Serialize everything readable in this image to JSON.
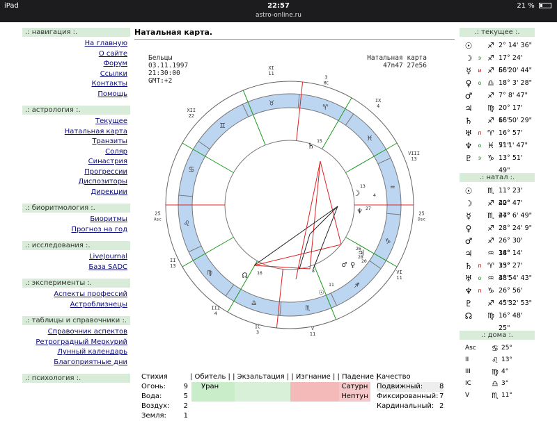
{
  "status_bar": {
    "device": "iPad",
    "time": "22:57",
    "url": "astro-online.ru",
    "battery": "21 %"
  },
  "left_nav": [
    {
      "title": ".: навигация :.",
      "links": [
        "На главную",
        "О сайте",
        "Форум",
        "Ссылки",
        "Контакты",
        "Помощь"
      ]
    },
    {
      "title": ".: астрология :.",
      "links": [
        "Текущее",
        "Натальная карта",
        "Транзиты",
        "Соляр",
        "Синастрия",
        "Прогрессии",
        "Диспозиторы",
        "Дирекции"
      ]
    },
    {
      "title": ".: биоритмология :.",
      "links": [
        "Биоритмы",
        "Прогноз на год"
      ]
    },
    {
      "title": ".: исследования :.",
      "links": [
        "LiveJournal",
        "База SADC"
      ]
    },
    {
      "title": ".: эксперименты :.",
      "links": [
        "Аспекты профессий",
        "Астроблизнецы"
      ]
    },
    {
      "title": ".: таблицы и справочники :.",
      "links": [
        "Справочник аспектов",
        "Ретроградный Меркурий",
        "Лунный календарь",
        "Благоприятные дни"
      ]
    },
    {
      "title": ".: психология :.",
      "links": []
    }
  ],
  "main": {
    "title": "Натальная карта.",
    "chart_info_left": "Бельцы\n03.11.1997\n21:30:00\nGMT:+2",
    "chart_info_right_title": "Натальная карта",
    "chart_info_right_coords": "47n47  27e56",
    "houses_wheel": [
      {
        "label": "XI",
        "num": "11"
      },
      {
        "label": "",
        "num": "3",
        "sub": "MC"
      },
      {
        "label": "IX",
        "num": "4"
      },
      {
        "label": "VIII",
        "num": "13"
      },
      {
        "label": "",
        "num": "25",
        "sub": "Dsc"
      },
      {
        "label": "VI",
        "num": "11"
      },
      {
        "label": "V",
        "num": "11"
      },
      {
        "label": "IC",
        "num": "3"
      },
      {
        "label": "III",
        "num": "4"
      },
      {
        "label": "II",
        "num": "13"
      },
      {
        "label": "",
        "num": "25",
        "sub": "Asc"
      },
      {
        "label": "XII",
        "num": "22"
      }
    ],
    "chart_planet_labels": [
      "15",
      "13",
      "27",
      "4",
      "26",
      "20",
      "28",
      "16",
      "11",
      "8"
    ]
  },
  "elements": {
    "header": {
      "element": "Стихия",
      "cols": "| Обитель | | Экзальтация | | Изгнание | | Падение |",
      "quality": "Качество"
    },
    "rows": [
      {
        "name": "Огонь:",
        "value": "9"
      },
      {
        "name": "Вода:",
        "value": "5"
      },
      {
        "name": "Воздух:",
        "value": "2"
      },
      {
        "name": "Земля:",
        "value": "1"
      }
    ],
    "dignity": {
      "obitel": "Уран",
      "padenie_1": "Сатурн",
      "padenie_2": "Нептун"
    },
    "qualities": [
      {
        "name": "Подвижный:",
        "value": "8"
      },
      {
        "name": "Фиксированный:",
        "value": "7"
      },
      {
        "name": "Кардинальный:",
        "value": "2"
      }
    ]
  },
  "right": {
    "current_title": ".: текущее :.",
    "current": [
      {
        "sym": "☉",
        "status": "",
        "sign": "♐",
        "deg": "2° 14' 36\""
      },
      {
        "sym": "☽",
        "status": "э",
        "stc": "green",
        "sign": "♐",
        "deg": "17° 24' 56\""
      },
      {
        "sym": "☿",
        "status": "и",
        "stc": "red",
        "sign": "♐",
        "deg": "6° 20' 44\""
      },
      {
        "sym": "♀",
        "status": "о",
        "stc": "green",
        "sign": "♎",
        "deg": "18° 3' 28\""
      },
      {
        "sym": "♂",
        "status": "",
        "sign": "♐",
        "deg": "7° 8' 47\""
      },
      {
        "sym": "♃",
        "status": "",
        "sign": "♍",
        "deg": "20° 17' 16\""
      },
      {
        "sym": "♄",
        "status": "",
        "sign": "♐",
        "deg": "6° 50' 29\""
      },
      {
        "sym": "♅",
        "status": "п",
        "stc": "red",
        "sign": "♈",
        "deg": "16° 57' 51\""
      },
      {
        "sym": "♆",
        "status": "о",
        "stc": "green",
        "sign": "♓",
        "deg": "7° 1' 47\""
      },
      {
        "sym": "♇",
        "status": "э",
        "stc": "green",
        "sign": "♑",
        "deg": "13° 51' 49\""
      }
    ],
    "natal_title": ".: натал :.",
    "natal": [
      {
        "sym": "☉",
        "status": "",
        "sign": "♏",
        "deg": "11° 23' 42\""
      },
      {
        "sym": "☽",
        "status": "",
        "sign": "♐",
        "deg": "20° 47' 47\""
      },
      {
        "sym": "☿",
        "status": "",
        "sign": "♏",
        "deg": "24° 6' 49\""
      },
      {
        "sym": "♀",
        "status": "",
        "sign": "♐",
        "deg": "28° 24' 9\""
      },
      {
        "sym": "♂",
        "status": "",
        "sign": "♐",
        "deg": "26° 30' 38\""
      },
      {
        "sym": "♃",
        "status": "",
        "sign": "♒",
        "deg": "14° 14' 33\""
      },
      {
        "sym": "♄",
        "status": "п",
        "stc": "red",
        "sign": "♈",
        "deg": "15° 27' 38\""
      },
      {
        "sym": "♅",
        "status": "о",
        "stc": "green",
        "sign": "♒",
        "deg": "4° 54' 43\""
      },
      {
        "sym": "♆",
        "status": "п",
        "stc": "red",
        "sign": "♑",
        "deg": "26° 56' 45\""
      },
      {
        "sym": "♇",
        "status": "",
        "sign": "♐",
        "deg": "4° 32' 53\""
      },
      {
        "sym": "☊",
        "status": "",
        "sign": "♍",
        "deg": "16° 48' 25\""
      }
    ],
    "houses_title": ".: дома :.",
    "houses": [
      {
        "name": "Asc",
        "sign": "♋",
        "deg": "25°"
      },
      {
        "name": "II",
        "sign": "♌",
        "deg": "13°"
      },
      {
        "name": "III",
        "sign": "♍",
        "deg": "4°"
      },
      {
        "name": "IC",
        "sign": "♎",
        "deg": "3°"
      },
      {
        "name": "V",
        "sign": "♏",
        "deg": "11°"
      }
    ]
  },
  "colors": {
    "nav_bg": "#d9ecd9",
    "link": "#0a0a7a",
    "wheel_ring": "#bcd6f2",
    "aspect_red": "#e02020",
    "aspect_green": "#1a9a1a"
  }
}
